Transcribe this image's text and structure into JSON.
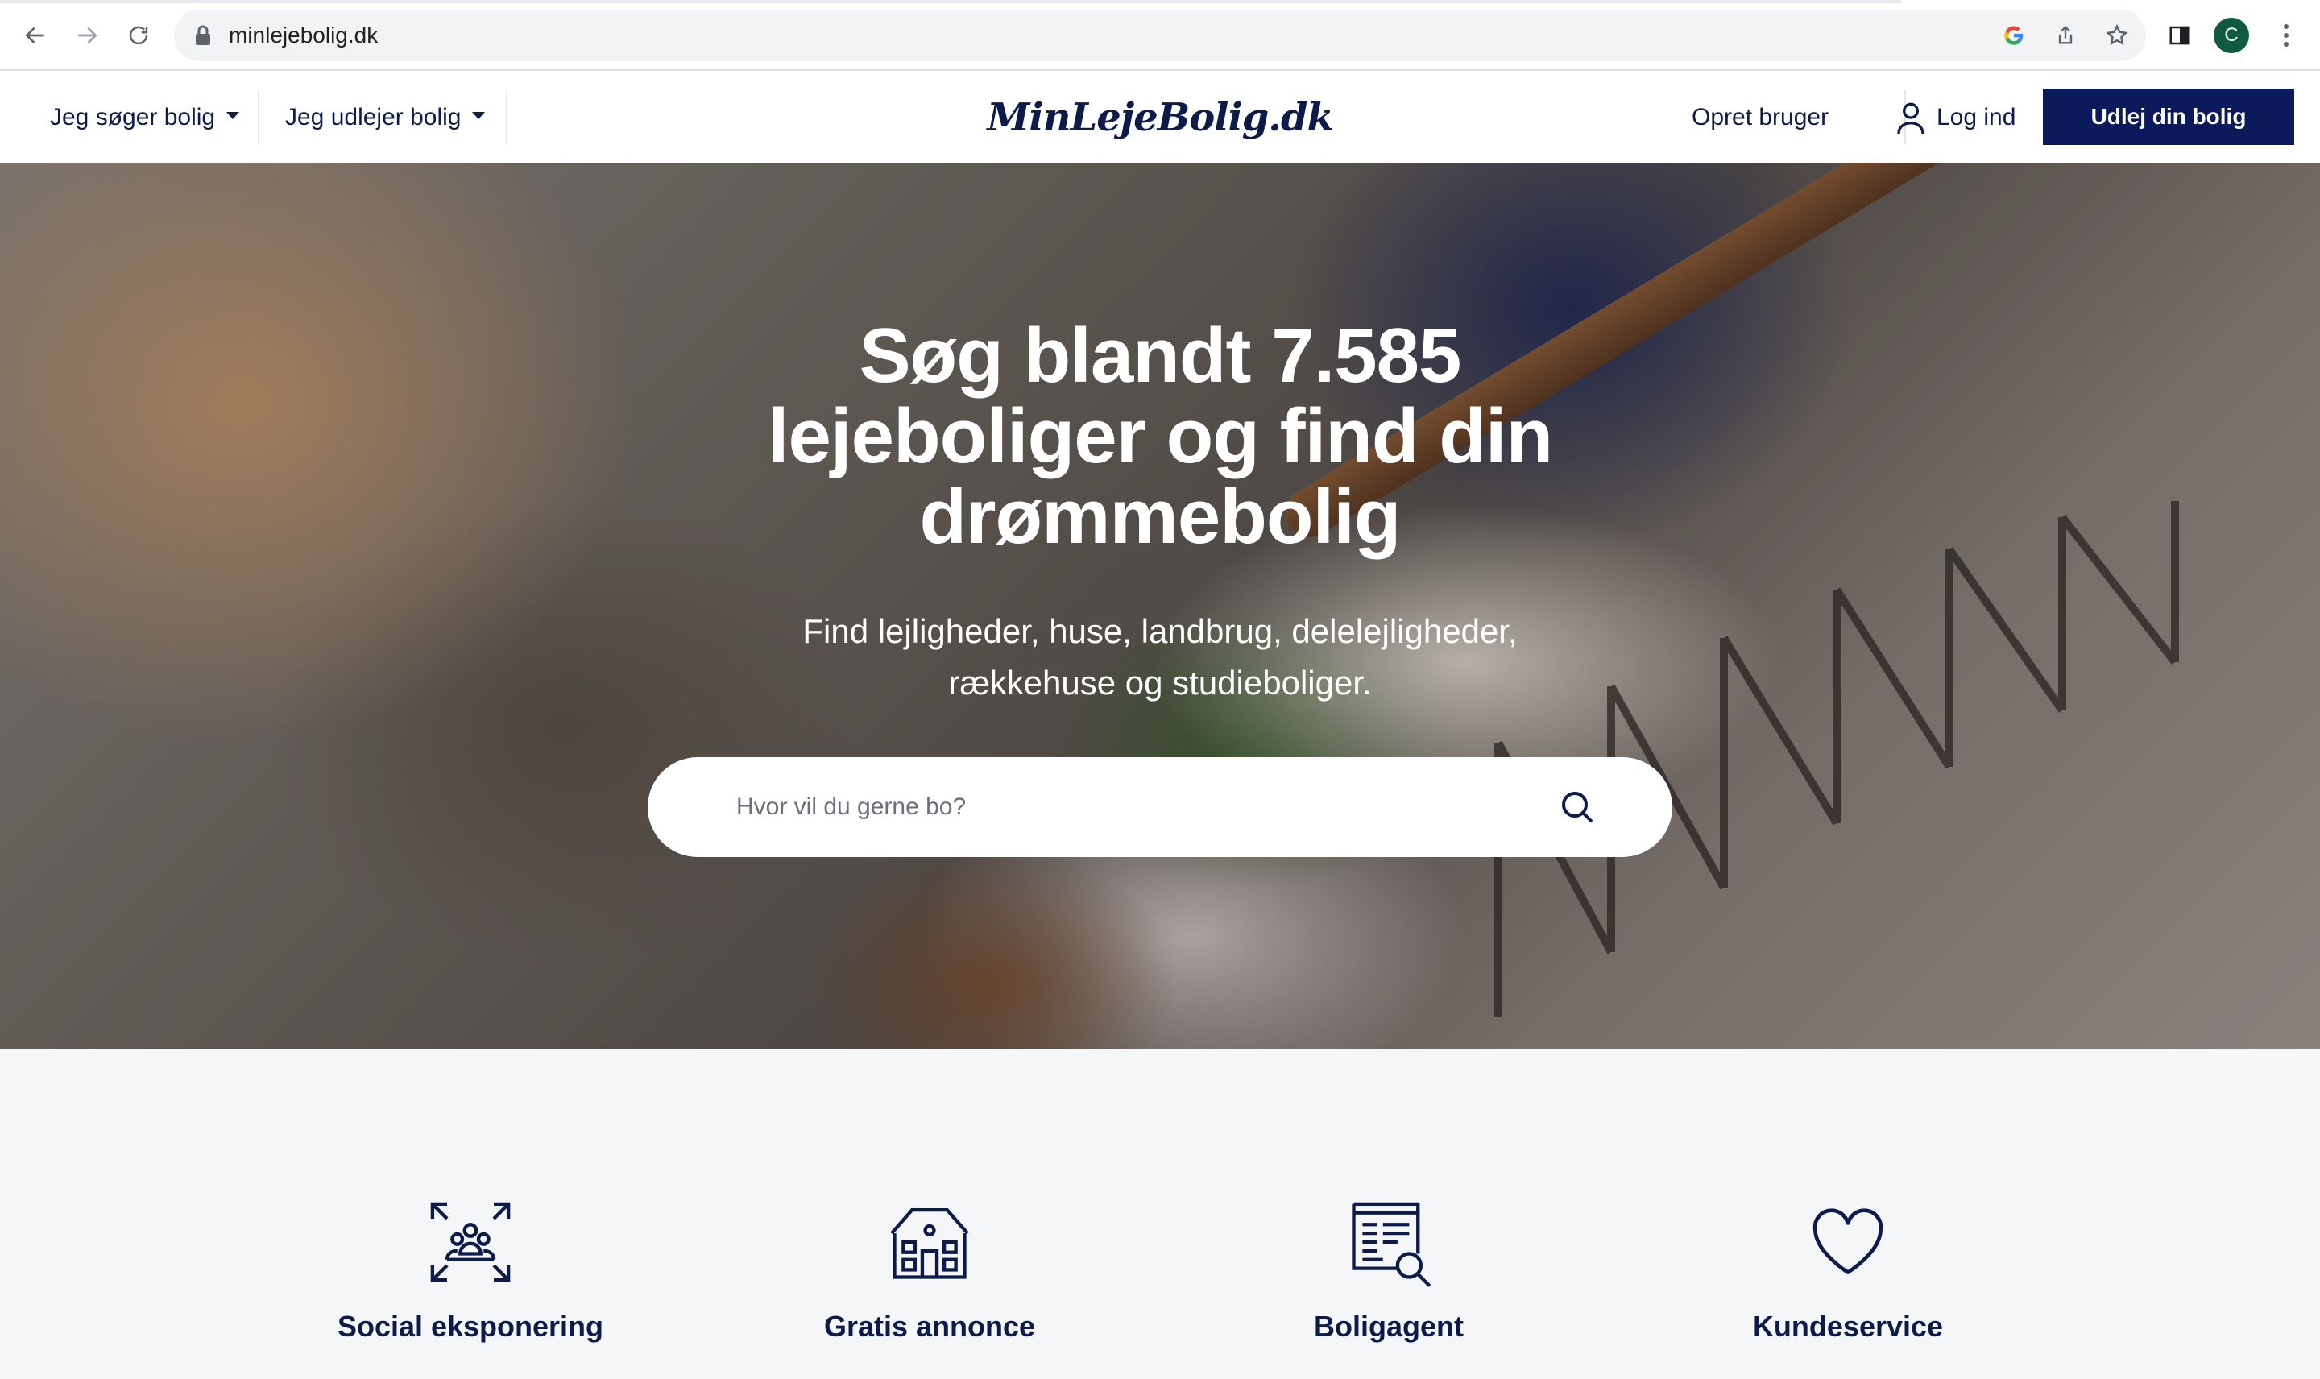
{
  "browser": {
    "url": "minlejebolig.dk",
    "profile_initial": "C"
  },
  "header": {
    "menu_seek": "Jeg søger bolig",
    "menu_rent_out": "Jeg udlejer bolig",
    "logo_text": "MinLejeBolig.dk",
    "create_user": "Opret bruger",
    "login": "Log ind",
    "cta": "Udlej din bolig"
  },
  "hero": {
    "title": "Søg blandt 7.585 lejeboliger og find din drømmebolig",
    "subtitle": "Find lejligheder, huse, landbrug, delelejligheder, rækkehuse og studieboliger.",
    "search_placeholder": "Hvor vil du gerne bo?"
  },
  "features": [
    {
      "title": "Social eksponering",
      "icon": "people-focus-icon"
    },
    {
      "title": "Gratis annonce",
      "icon": "house-icon"
    },
    {
      "title": "Boligagent",
      "icon": "document-search-icon"
    },
    {
      "title": "Kundeservice",
      "icon": "heart-icon"
    }
  ],
  "colors": {
    "brand_navy": "#0b1a5a",
    "text_navy": "#0d1b4b",
    "features_bg": "#f5f6f8"
  }
}
